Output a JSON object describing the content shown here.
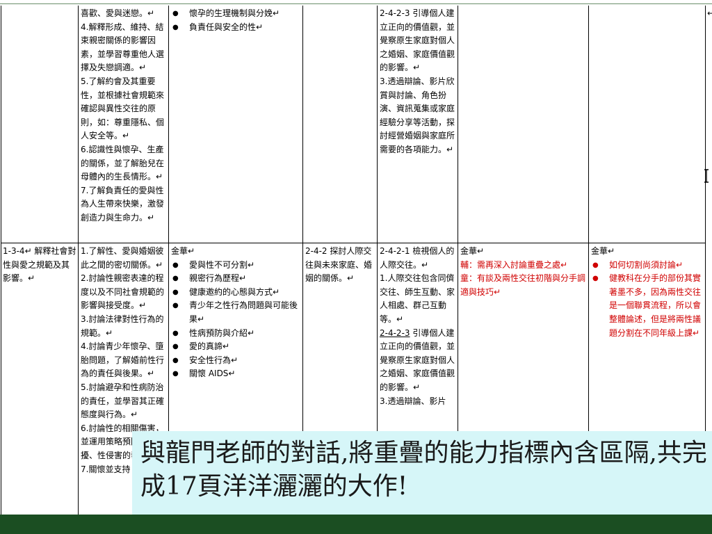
{
  "row1": {
    "goals": [
      "喜歡、愛與迷戀。↵",
      "4.解釋形成、維持、結束親密關係的影響因素，並學習尊重他人選擇及失戀調適。↵",
      "5.了解約會及其重要性，並根據社會規範來確認與異性交往的原則，如：尊重隱私、個人安全等。↵",
      "6.認識性與懷孕、生產的關係，並了解胎兒在母體內的生長情形。↵",
      "7.了解負責任的愛與性為人生帶來快樂，激發創造力與生命力。↵"
    ],
    "topics": [
      "懷孕的生理機制與分娩↵",
      "負責任與安全的性↵"
    ],
    "indicators": [
      {
        "text": "2-4-2-3 引導個人建立正向的價值觀，並覺察原生家庭對個人之婚姻、家庭價值觀的影響。↵",
        "underline": false
      },
      {
        "text": "3.透過辯論、影片欣賞與討論、角色扮演、資訊蒐集或家庭經驗分享等活動，探討經營婚姻與家庭所需要的各項能力。↵",
        "underline": false
      }
    ]
  },
  "row2": {
    "unit": "1-3-4↵ 解釋社會對性與愛之規範及其影響。↵",
    "goals": [
      "1.了解性、愛與婚姻彼此之間的密切關係。↵",
      "2.討論性親密表達的程度以及不同社會規範的影響與接受度。↵",
      "3.討論法律對性行為的規範。↵",
      "4.討論青少年懷孕、墮胎問題，了解婚前性行為的責任與後果。↵",
      "5.討論避孕和性病防治的責任，並學習其正確態度與行為。↵",
      "6.討論性的相關傷害，並運用策略預防性騷擾、性侵害的發生。↵",
      "7.關懷並支持"
    ],
    "topics_head": "金華↵",
    "topics": [
      "愛與性不可分割↵",
      "親密行為歷程↵",
      "健康邀約的心態與方式↵",
      "青少年之性行為問題與可能後果↵",
      "性病預防與介紹↵",
      "愛的真諦↵",
      "安全性行為↵",
      "關懷 AIDS↵"
    ],
    "family_ind": "2-4-2 探討人際交往與未來家庭、婚姻的關係。↵",
    "indicators": [
      {
        "text": "2-4-2-1 檢視個人的人際交往。↵",
        "underline": false
      },
      {
        "text": "1.人際交往包含同儕交往、師生互動、家人相處、群己互動等。↵",
        "underline": false
      },
      {
        "text": "2-4-2-3",
        "underline": true
      },
      {
        "text": " 引導個人建立正向的價值觀，並覺察原生家庭對個人之婚姻、家庭價值觀的影響。↵",
        "underline": false
      },
      {
        "text": "3.透過辯論、影片",
        "underline": false
      }
    ],
    "note_head": "金華↵",
    "note_lines": [
      "輔：需再深入討論重疊之處↵",
      "童：有談及兩性交往初階與分手調適與技巧↵"
    ],
    "comment_head": "金華↵",
    "comments": [
      "如何切割尚須討論↵",
      "健教科在分手的部份其實著墨不多，因為兩性交往是一個聯貫流程，所以會整體論述，但是將兩性議題分割在不同年級上課↵"
    ]
  },
  "caption": "與龍門老師的對話,將重疊的能力指標內含區隔,共完成17頁洋洋灑灑的大作!",
  "colors": {
    "caption_bg": "#d6f6f8",
    "footer_bg": "#1b4e22",
    "note_red": "#d00000"
  },
  "icons": [
    "text-cursor-icon"
  ]
}
